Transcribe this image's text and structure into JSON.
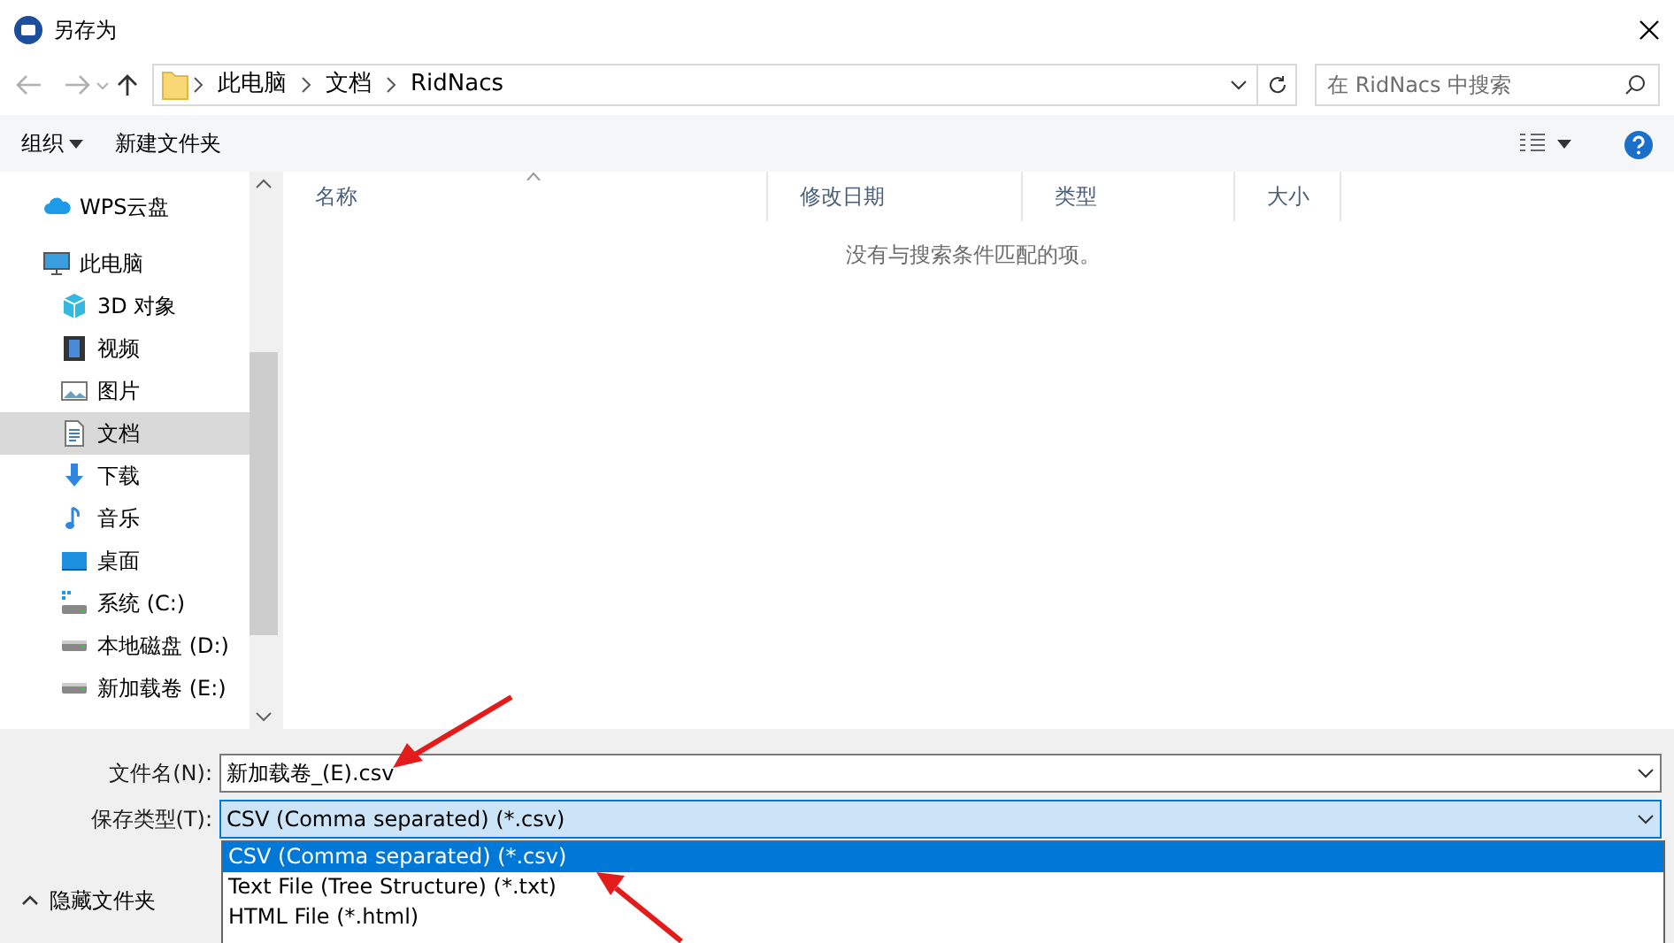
{
  "window": {
    "title": "另存为"
  },
  "address": {
    "breadcrumb": [
      "此电脑",
      "文档",
      "RidNacs"
    ],
    "search": {
      "placeholder": "在 RidNacs 中搜索"
    }
  },
  "toolbar": {
    "organize": "组织",
    "new_folder": "新建文件夹"
  },
  "sidebar": {
    "items": [
      {
        "label": "WPS云盘",
        "kind": "cloud",
        "selected": false
      },
      {
        "label": "此电脑",
        "kind": "pc",
        "selected": false,
        "children": [
          {
            "label": "3D 对象",
            "kind": "cube",
            "selected": false
          },
          {
            "label": "视频",
            "kind": "film",
            "selected": false
          },
          {
            "label": "图片",
            "kind": "picture",
            "selected": false
          },
          {
            "label": "文档",
            "kind": "document",
            "selected": true
          },
          {
            "label": "下载",
            "kind": "download",
            "selected": false
          },
          {
            "label": "音乐",
            "kind": "music",
            "selected": false
          },
          {
            "label": "桌面",
            "kind": "desktop",
            "selected": false
          },
          {
            "label": "系统 (C:)",
            "kind": "system-drive",
            "selected": false
          },
          {
            "label": "本地磁盘 (D:)",
            "kind": "drive",
            "selected": false
          },
          {
            "label": "新加载卷 (E:)",
            "kind": "drive",
            "selected": false
          }
        ]
      }
    ]
  },
  "file_list": {
    "columns": [
      "名称",
      "修改日期",
      "类型",
      "大小"
    ],
    "empty_message": "没有与搜索条件匹配的项。"
  },
  "form": {
    "filename_label": "文件名(N):",
    "filename": "新加载卷_(E).csv",
    "type_label": "保存类型(T):",
    "type_value": "CSV (Comma separated) (*.csv)",
    "options": [
      {
        "label": "CSV (Comma separated) (*.csv)",
        "selected": true
      },
      {
        "label": "Text File (Tree Structure) (*.txt)",
        "selected": false
      },
      {
        "label": "HTML File (*.html)",
        "selected": false
      }
    ]
  },
  "hide_folders": "隐藏文件夹"
}
